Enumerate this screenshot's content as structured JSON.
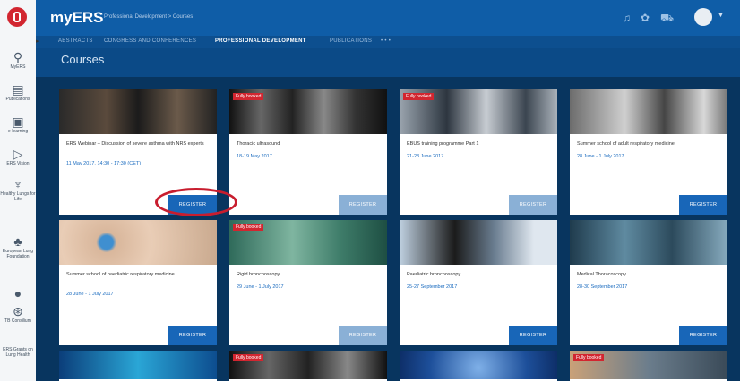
{
  "sidebar": {
    "items": [
      {
        "label": "MyERS",
        "icon": "person-icon"
      },
      {
        "label": "Publications",
        "icon": "book-icon"
      },
      {
        "label": "e-learning",
        "icon": "monitor-icon"
      },
      {
        "label": "ERS Vision",
        "icon": "play-icon"
      },
      {
        "label": "Healthy Lungs for Life",
        "icon": "lungs-icon"
      },
      {
        "label": "European Lung Foundation",
        "icon": "tree-icon"
      },
      {
        "label": "",
        "icon": "globe-icon"
      },
      {
        "label": "TB Consilium",
        "icon": "globe-network-icon"
      },
      {
        "label": "ERS Grants on Lung Health",
        "icon": "document-icon"
      }
    ]
  },
  "header": {
    "brand": "myERS",
    "breadcrumb": "Professional Development  >  Courses"
  },
  "nav": {
    "items": [
      {
        "label": "ABSTRACTS",
        "active": false
      },
      {
        "label": "CONGRESS AND CONFERENCES",
        "active": false
      },
      {
        "label": "PROFESSIONAL DEVELOPMENT",
        "active": true
      },
      {
        "label": "PUBLICATIONS",
        "active": false
      },
      {
        "label": "• • •",
        "active": false
      }
    ]
  },
  "page": {
    "title": "Courses"
  },
  "courses": [
    {
      "title": "ERS Webinar – Discussion of severe asthma with NRS experts",
      "date": "11 May 2017, 14:30 - 17:30 (CET)",
      "register_label": "REGISTER",
      "fully_booked": false,
      "badge": ""
    },
    {
      "title": "Thoracic ultrasound",
      "date": "18-19 May 2017",
      "register_label": "REGISTER",
      "fully_booked": true,
      "badge": "Fully booked"
    },
    {
      "title": "EBUS training programme Part 1",
      "date": "21-23 June 2017",
      "register_label": "REGISTER",
      "fully_booked": true,
      "badge": "Fully booked"
    },
    {
      "title": "Summer school of adult respiratory medicine",
      "date": "28 June - 1 July 2017",
      "register_label": "REGISTER",
      "fully_booked": false,
      "badge": ""
    },
    {
      "title": "Summer school of paediatric respiratory medicine",
      "date": "28 June - 1 July 2017",
      "register_label": "REGISTER",
      "fully_booked": false,
      "badge": ""
    },
    {
      "title": "Rigid bronchoscopy",
      "date": "29 June - 1 July 2017",
      "register_label": "REGISTER",
      "fully_booked": true,
      "badge": "Fully booked"
    },
    {
      "title": "Paediatric bronchoscopy",
      "date": "25-27 September 2017",
      "register_label": "REGISTER",
      "fully_booked": false,
      "badge": ""
    },
    {
      "title": "Medical Thoracoscopy",
      "date": "28-30 September 2017",
      "register_label": "REGISTER",
      "fully_booked": false,
      "badge": ""
    },
    {
      "title": "",
      "date": "",
      "register_label": "",
      "fully_booked": false,
      "badge": ""
    },
    {
      "title": "",
      "date": "",
      "register_label": "",
      "fully_booked": true,
      "badge": "Fully booked"
    },
    {
      "title": "",
      "date": "",
      "register_label": "",
      "fully_booked": false,
      "badge": ""
    },
    {
      "title": "",
      "date": "",
      "register_label": "",
      "fully_booked": true,
      "badge": "Fully booked"
    }
  ],
  "colors": {
    "brand_blue": "#0f5da7",
    "content_bg": "#08355f",
    "register_blue": "#1866b8",
    "register_disabled": "#8ab0d6",
    "badge_red": "#d22630",
    "annotation_red": "#c81d2e"
  }
}
